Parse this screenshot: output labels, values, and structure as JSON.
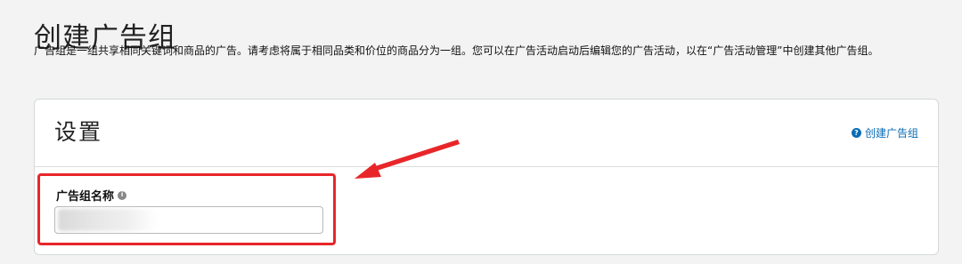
{
  "page": {
    "title": "创建广告组",
    "description": "广告组是一组共享相同关键词和商品的广告。请考虑将属于相同品类和价位的商品分为一组。您可以在广告活动启动后编辑您的广告活动，以在“广告活动管理”中创建其他广告组。"
  },
  "settings": {
    "section_title": "设置",
    "help_link_label": "创建广告组",
    "help_icon": "question-circle-icon",
    "ad_group_name": {
      "label": "广告组名称",
      "info_icon": "info-circle-icon",
      "value": ""
    }
  },
  "annotation": {
    "highlight_color": "#e8262a"
  },
  "colors": {
    "link": "#0a6bb5",
    "background": "#f3f3f3",
    "card": "#ffffff"
  }
}
